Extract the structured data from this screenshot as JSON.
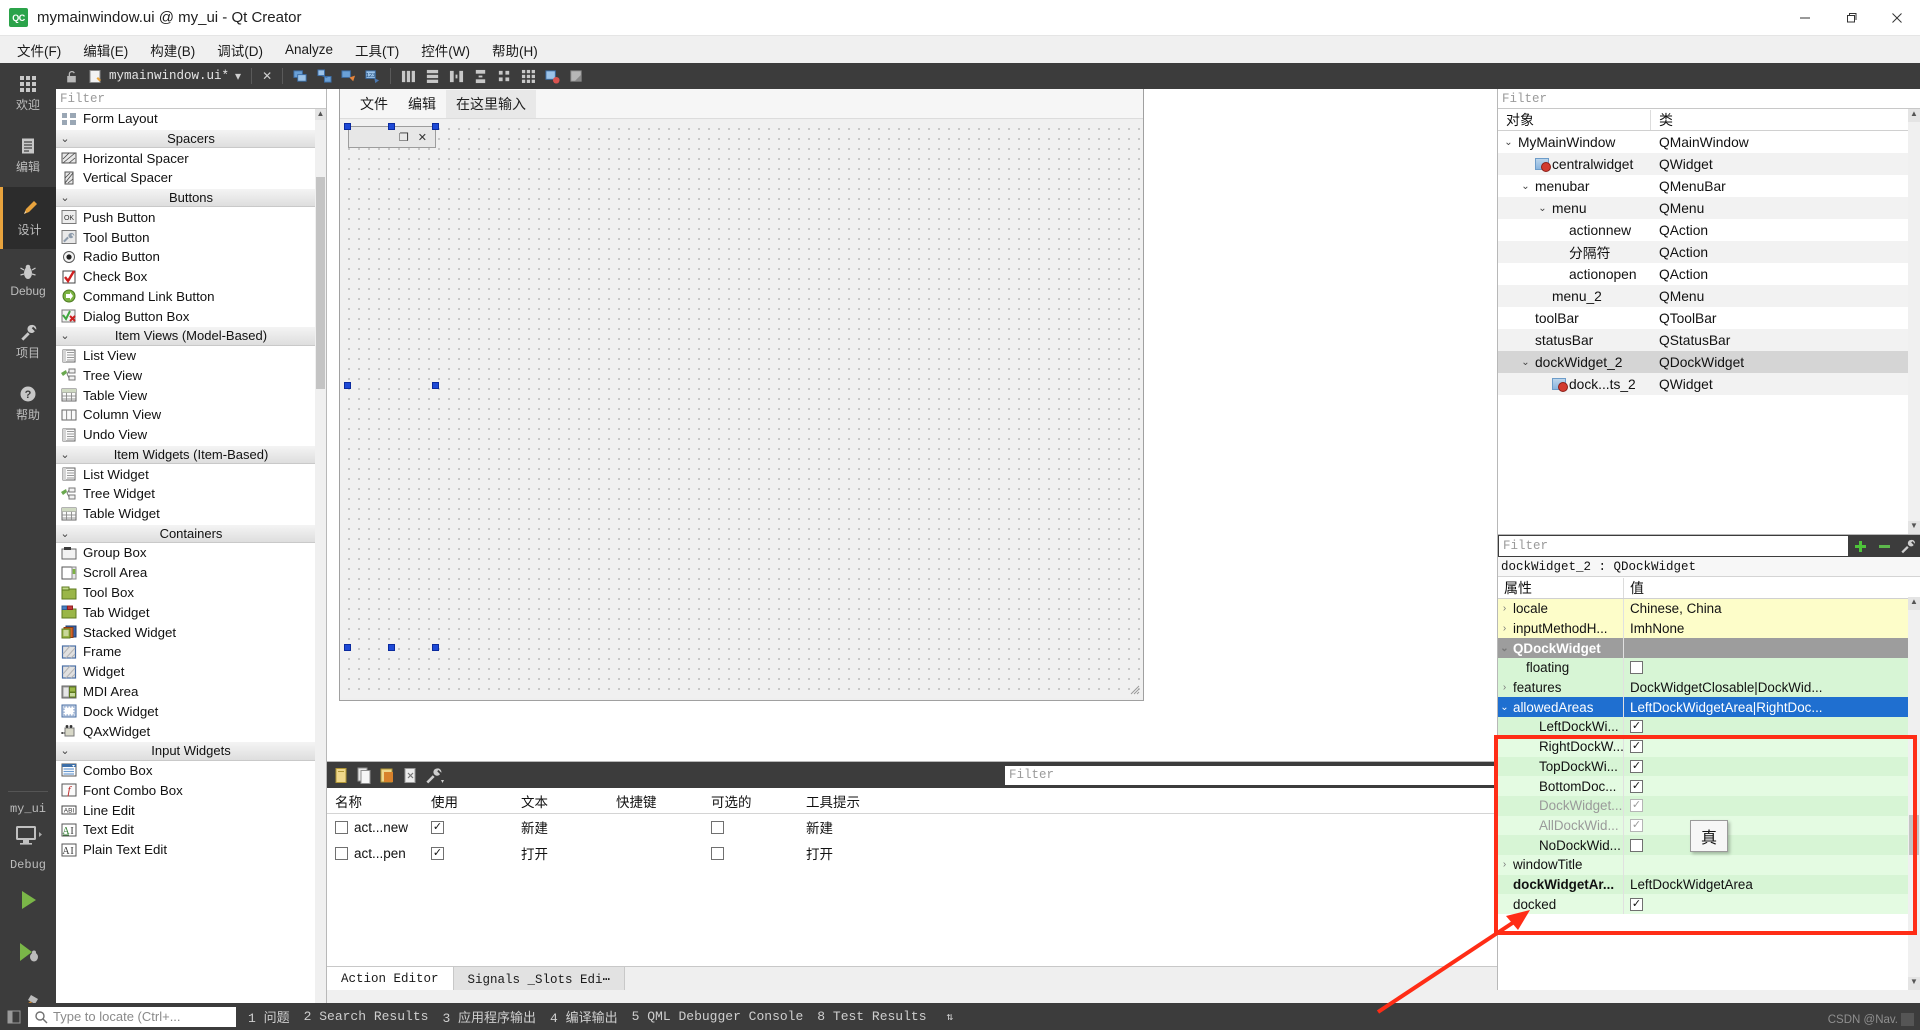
{
  "window": {
    "title": "mymainwindow.ui @ my_ui - Qt Creator",
    "app_icon_text": "QC",
    "minimize": "—",
    "maximize": "❐",
    "close": "✕"
  },
  "menubar": {
    "items": [
      {
        "text": "文件(F)",
        "mnemonic": "F"
      },
      {
        "text": "编辑(E)",
        "mnemonic": "E"
      },
      {
        "text": "构建(B)",
        "mnemonic": "B"
      },
      {
        "text": "调试(D)",
        "mnemonic": "D"
      },
      {
        "text": "Analyze",
        "mnemonic": "A"
      },
      {
        "text": "工具(T)",
        "mnemonic": "T"
      },
      {
        "text": "控件(W)",
        "mnemonic": "W"
      },
      {
        "text": "帮助(H)",
        "mnemonic": "H"
      }
    ]
  },
  "modebar": {
    "items": [
      {
        "label": "欢迎",
        "icon": "grid-icon"
      },
      {
        "label": "编辑",
        "icon": "document-icon"
      },
      {
        "label": "设计",
        "icon": "pencil-icon",
        "active": true
      },
      {
        "label": "Debug",
        "icon": "bug-icon"
      },
      {
        "label": "项目",
        "icon": "wrench-icon"
      },
      {
        "label": "帮助",
        "icon": "question-icon"
      }
    ],
    "kit": {
      "project": "my_ui",
      "build_config": "Debug",
      "run_label": "run-button",
      "debug_label": "debug-button",
      "build_label": "build-button"
    }
  },
  "editor_toolbar": {
    "filename": "mymainwindow.ui*",
    "lock_icon": "unlock-icon",
    "file_icon": "ui-file-icon",
    "dropdown": "▾",
    "close_icon": "✕",
    "buttons": [
      "edit-buddies-icon",
      "edit-tab-order-icon",
      "edit-signals-slots-icon",
      "edit-widgets-icon",
      "lay-out-horizontally-icon",
      "lay-out-vertically-icon",
      "lay-out-splitter-h-icon",
      "lay-out-splitter-v-icon",
      "lay-out-form-icon",
      "lay-out-grid-icon",
      "break-layout-icon",
      "adjust-size-icon"
    ]
  },
  "widget_box": {
    "filter_placeholder": "Filter",
    "groups": [
      {
        "title": "",
        "partial": true,
        "items": [
          {
            "label": "Form Layout",
            "icon": "form-layout-icon"
          }
        ]
      },
      {
        "title": "Spacers",
        "items": [
          {
            "label": "Horizontal Spacer",
            "icon": "horizontal-spacer-icon"
          },
          {
            "label": "Vertical Spacer",
            "icon": "vertical-spacer-icon"
          }
        ]
      },
      {
        "title": "Buttons",
        "items": [
          {
            "label": "Push Button",
            "icon": "push-button-icon"
          },
          {
            "label": "Tool Button",
            "icon": "tool-button-icon"
          },
          {
            "label": "Radio Button",
            "icon": "radio-button-icon"
          },
          {
            "label": "Check Box",
            "icon": "check-box-icon"
          },
          {
            "label": "Command Link Button",
            "icon": "command-link-button-icon"
          },
          {
            "label": "Dialog Button Box",
            "icon": "dialog-button-box-icon"
          }
        ]
      },
      {
        "title": "Item Views (Model-Based)",
        "items": [
          {
            "label": "List View",
            "icon": "list-view-icon"
          },
          {
            "label": "Tree View",
            "icon": "tree-view-icon"
          },
          {
            "label": "Table View",
            "icon": "table-view-icon"
          },
          {
            "label": "Column View",
            "icon": "column-view-icon"
          },
          {
            "label": "Undo View",
            "icon": "undo-view-icon"
          }
        ]
      },
      {
        "title": "Item Widgets (Item-Based)",
        "items": [
          {
            "label": "List Widget",
            "icon": "list-widget-icon"
          },
          {
            "label": "Tree Widget",
            "icon": "tree-widget-icon"
          },
          {
            "label": "Table Widget",
            "icon": "table-widget-icon"
          }
        ]
      },
      {
        "title": "Containers",
        "items": [
          {
            "label": "Group Box",
            "icon": "group-box-icon"
          },
          {
            "label": "Scroll Area",
            "icon": "scroll-area-icon"
          },
          {
            "label": "Tool Box",
            "icon": "tool-box-icon"
          },
          {
            "label": "Tab Widget",
            "icon": "tab-widget-icon"
          },
          {
            "label": "Stacked Widget",
            "icon": "stacked-widget-icon"
          },
          {
            "label": "Frame",
            "icon": "frame-icon"
          },
          {
            "label": "Widget",
            "icon": "widget-icon"
          },
          {
            "label": "MDI Area",
            "icon": "mdi-area-icon"
          },
          {
            "label": "Dock Widget",
            "icon": "dock-widget-icon"
          },
          {
            "label": "QAxWidget",
            "icon": "qax-widget-icon"
          }
        ]
      },
      {
        "title": "Input Widgets",
        "items": [
          {
            "label": "Combo Box",
            "icon": "combo-box-icon"
          },
          {
            "label": "Font Combo Box",
            "icon": "font-combo-box-icon"
          },
          {
            "label": "Line Edit",
            "icon": "line-edit-icon"
          },
          {
            "label": "Text Edit",
            "icon": "text-edit-icon"
          },
          {
            "label": "Plain Text Edit",
            "icon": "plain-text-edit-icon"
          }
        ]
      }
    ]
  },
  "form": {
    "menu_items": [
      "文件",
      "编辑"
    ],
    "menu_placeholder": "在这里输入",
    "dock_float_icon": "❐",
    "dock_close_icon": "✕"
  },
  "action_editor": {
    "toolbar_icons": [
      "new-action-icon",
      "copy-action-icon",
      "paste-action-icon",
      "delete-action-icon",
      "configure-icon"
    ],
    "filter_placeholder": "Filter",
    "columns": [
      "名称",
      "使用",
      "文本",
      "快捷键",
      "可选的",
      "工具提示"
    ],
    "rows": [
      {
        "name": "act...new",
        "used": true,
        "text": "新建",
        "shortcut": "",
        "checkable": false,
        "tooltip": "新建"
      },
      {
        "name": "act...pen",
        "used": true,
        "text": "打开",
        "shortcut": "",
        "checkable": false,
        "tooltip": "打开"
      }
    ],
    "tabs": [
      {
        "label": "Action Editor",
        "active": true
      },
      {
        "label": "Signals _Slots Edi⋯",
        "active": false
      }
    ]
  },
  "object_tree": {
    "filter_placeholder": "Filter",
    "columns": [
      "对象",
      "类"
    ],
    "rows": [
      {
        "name": "MyMainWindow",
        "class": "QMainWindow",
        "indent": 0,
        "chevron": "⌄",
        "icon": null,
        "selected": false
      },
      {
        "name": "centralwidget",
        "class": "QWidget",
        "indent": 1,
        "chevron": "",
        "icon": "no-layout-icon",
        "selected": false
      },
      {
        "name": "menubar",
        "class": "QMenuBar",
        "indent": 1,
        "chevron": "⌄",
        "icon": null,
        "selected": false
      },
      {
        "name": "menu",
        "class": "QMenu",
        "indent": 2,
        "chevron": "⌄",
        "icon": null,
        "selected": false
      },
      {
        "name": "actionnew",
        "class": "QAction",
        "indent": 3,
        "chevron": "",
        "icon": null,
        "selected": false
      },
      {
        "name": "分隔符",
        "class": "QAction",
        "indent": 3,
        "chevron": "",
        "icon": null,
        "selected": false
      },
      {
        "name": "actionopen",
        "class": "QAction",
        "indent": 3,
        "chevron": "",
        "icon": null,
        "selected": false
      },
      {
        "name": "menu_2",
        "class": "QMenu",
        "indent": 2,
        "chevron": "",
        "icon": null,
        "selected": false
      },
      {
        "name": "toolBar",
        "class": "QToolBar",
        "indent": 1,
        "chevron": "",
        "icon": null,
        "selected": false
      },
      {
        "name": "statusBar",
        "class": "QStatusBar",
        "indent": 1,
        "chevron": "",
        "icon": null,
        "selected": false
      },
      {
        "name": "dockWidget_2",
        "class": "QDockWidget",
        "indent": 1,
        "chevron": "⌄",
        "icon": null,
        "selected": true
      },
      {
        "name": "dock...ts_2",
        "class": "QWidget",
        "indent": 2,
        "chevron": "",
        "icon": "no-layout-icon",
        "selected": false
      }
    ]
  },
  "property_editor": {
    "filter_placeholder": "Filter",
    "add_icon": "plus-icon",
    "remove_icon": "minus-icon",
    "configure_icon": "wrench-icon",
    "object_header": "dockWidget_2 : QDockWidget",
    "columns": [
      "属性",
      "值"
    ],
    "rows": [
      {
        "key": "locale",
        "value": "Chinese, China",
        "style": "yellow",
        "indent": 0,
        "chevron": "›",
        "type": "text"
      },
      {
        "key": "inputMethodH...",
        "value": "ImhNone",
        "style": "yellow",
        "indent": 0,
        "chevron": "›",
        "type": "text"
      },
      {
        "key": "QDockWidget",
        "value": "",
        "style": "group",
        "indent": 0,
        "chevron": "⌄",
        "type": "group"
      },
      {
        "key": "floating",
        "value": "",
        "style": "green",
        "indent": 1,
        "chevron": "",
        "type": "checkbox",
        "checked": false
      },
      {
        "key": "features",
        "value": "DockWidgetClosable|DockWid...",
        "style": "green",
        "indent": 0,
        "chevron": "›",
        "type": "text"
      },
      {
        "key": "allowedAreas",
        "value": "LeftDockWidgetArea|RightDoc...",
        "style": "selected",
        "indent": 0,
        "chevron": "⌄",
        "type": "text"
      },
      {
        "key": "LeftDockWi...",
        "value": "",
        "style": "green",
        "indent": 2,
        "chevron": "",
        "type": "checkbox",
        "checked": true
      },
      {
        "key": "RightDockW...",
        "value": "",
        "style": "green2",
        "indent": 2,
        "chevron": "",
        "type": "checkbox",
        "checked": true
      },
      {
        "key": "TopDockWi...",
        "value": "",
        "style": "green",
        "indent": 2,
        "chevron": "",
        "type": "checkbox",
        "checked": true
      },
      {
        "key": "BottomDoc...",
        "value": "",
        "style": "green2",
        "indent": 2,
        "chevron": "",
        "type": "checkbox",
        "checked": true
      },
      {
        "key": "DockWidget...",
        "value": "",
        "style": "green",
        "indent": 2,
        "chevron": "",
        "type": "checkbox",
        "checked": true,
        "disabled": true
      },
      {
        "key": "AllDockWid...",
        "value": "",
        "style": "green2",
        "indent": 2,
        "chevron": "",
        "type": "checkbox",
        "checked": true,
        "disabled": true
      },
      {
        "key": "NoDockWid...",
        "value": "",
        "style": "green",
        "indent": 2,
        "chevron": "",
        "type": "checkbox",
        "checked": false
      },
      {
        "key": "windowTitle",
        "value": "",
        "style": "green2",
        "indent": 0,
        "chevron": "›",
        "type": "text"
      },
      {
        "key": "dockWidgetAr...",
        "value": "LeftDockWidgetArea",
        "style": "green",
        "indent": 0,
        "chevron": "",
        "type": "text",
        "bold": true
      },
      {
        "key": "docked",
        "value": "",
        "style": "green2",
        "indent": 0,
        "chevron": "",
        "type": "checkbox",
        "checked": true
      }
    ],
    "tooltip": "真",
    "annotation_color": "#ff2d16"
  },
  "statusbar": {
    "locate_placeholder": "Type to locate (Ctrl+...",
    "search_icon": "search-icon",
    "panes": [
      "1 问题",
      "2 Search Results",
      "3 应用程序输出",
      "4 编译输出",
      "5 QML Debugger Console",
      "8 Test Results"
    ],
    "updown": "⇅",
    "watermark": "CSDN @Nav."
  }
}
